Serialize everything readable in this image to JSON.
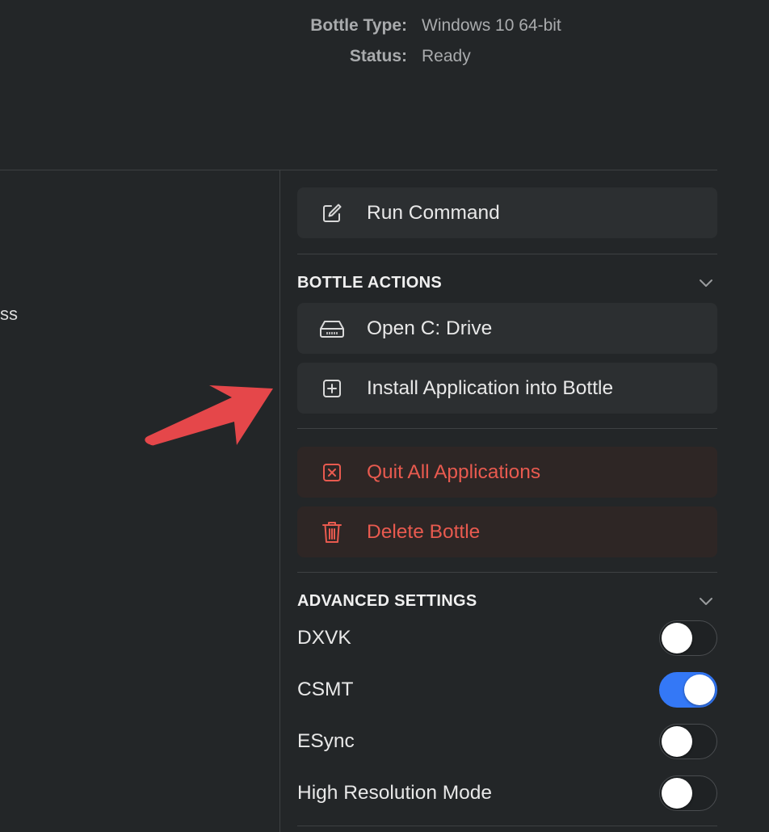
{
  "bottle_info": {
    "type_label": "Bottle Type:",
    "type_value": "Windows 10 64-bit",
    "status_label": "Status:",
    "status_value": "Ready"
  },
  "left_panel": {
    "fragment_text": "ss"
  },
  "run_command": {
    "label": "Run Command",
    "icon": "pencil-square-icon"
  },
  "bottle_actions": {
    "title": "BOTTLE ACTIONS",
    "open_c_drive": {
      "label": "Open C: Drive",
      "icon": "drive-icon"
    },
    "install_app": {
      "label": "Install Application into Bottle",
      "icon": "plus-square-icon"
    },
    "quit_all": {
      "label": "Quit All Applications",
      "icon": "x-square-icon"
    },
    "delete_bottle": {
      "label": "Delete Bottle",
      "icon": "trash-icon"
    }
  },
  "advanced_settings": {
    "title": "ADVANCED SETTINGS",
    "items": [
      {
        "label": "DXVK",
        "on": false
      },
      {
        "label": "CSMT",
        "on": true
      },
      {
        "label": "ESync",
        "on": false
      },
      {
        "label": "High Resolution Mode",
        "on": false
      }
    ]
  },
  "colors": {
    "background": "#232628",
    "button_bg": "#2c2f31",
    "danger_bg": "#2e2625",
    "danger_text": "#e85a4f",
    "toggle_on": "#3478f6",
    "annotation_arrow": "#e5474a"
  }
}
